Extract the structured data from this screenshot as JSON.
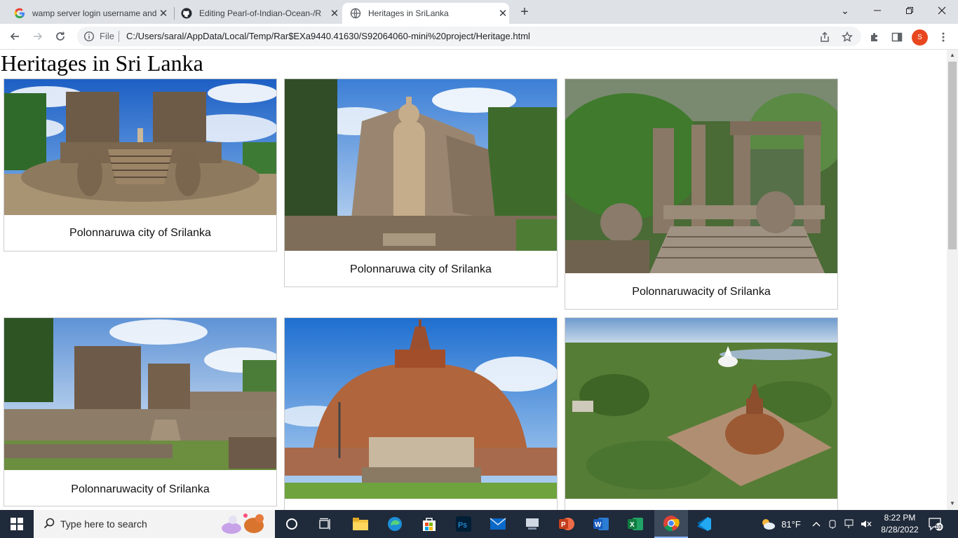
{
  "tabs": [
    {
      "title": "wamp server login username and",
      "favicon": "google-icon"
    },
    {
      "title": "Editing Pearl-of-Indian-Ocean-/R",
      "favicon": "github-icon"
    },
    {
      "title": "Heritages in SriLanka",
      "favicon": "globe-icon",
      "active": true
    }
  ],
  "address": {
    "scheme_label": "File",
    "url": "C:/Users/saral/AppData/Local/Temp/Rar$EXa9440.41630/S92064060-mini%20project/Heritage.html"
  },
  "profile_initial": "S",
  "page": {
    "title": "Heritages in Sri Lanka",
    "cards": [
      {
        "caption": "Polonnaruwa city of Srilanka",
        "image": "vatadage-image"
      },
      {
        "caption": "Polonnaruwa city of Srilanka",
        "image": "buddha-statue-image"
      },
      {
        "caption": "Polonnaruwacity of Srilanka",
        "image": "ruins-gateway-image"
      },
      {
        "caption": "Polonnaruwacity of Srilanka",
        "image": "palace-ruins-image"
      },
      {
        "caption": "",
        "image": "stupa-image"
      },
      {
        "caption": "",
        "image": "aerial-stupa-image"
      }
    ]
  },
  "taskbar": {
    "search_placeholder": "Type here to search",
    "weather": "81°F",
    "time": "8:22 PM",
    "date": "8/28/2022",
    "notifications": "10"
  },
  "colors": {
    "accent": "#e8461f",
    "taskbar": "#1f2a3a"
  }
}
